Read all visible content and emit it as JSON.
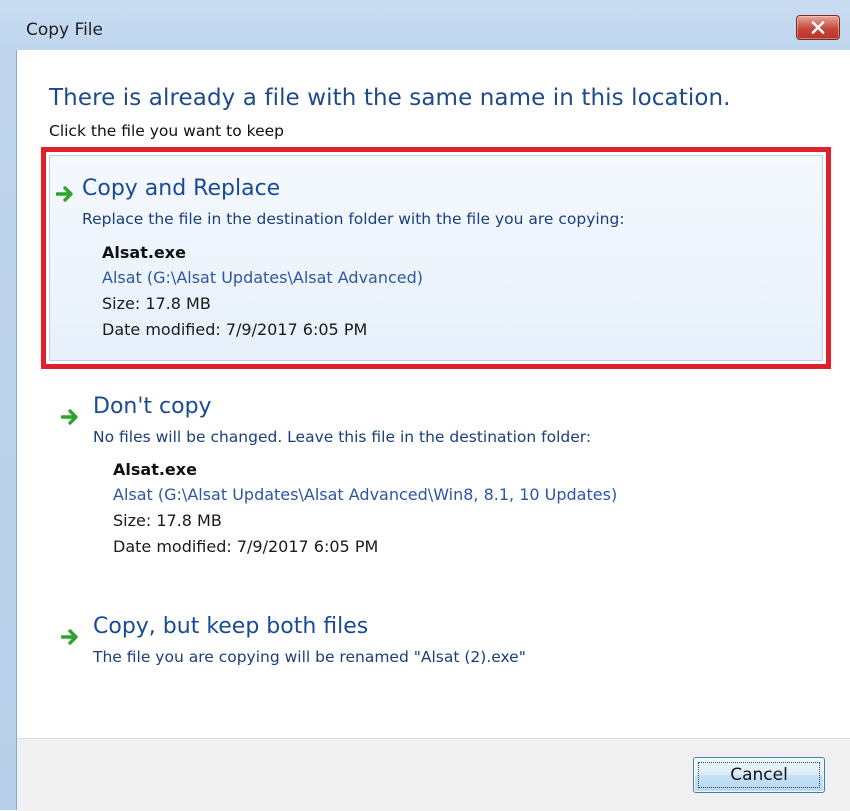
{
  "window": {
    "title": "Copy File",
    "close_icon": "close-icon"
  },
  "heading": "There is already a file with the same name in this location.",
  "subheading": "Click the file you want to keep",
  "options": [
    {
      "title": "Copy and Replace",
      "description": "Replace the file in the destination folder with the file you are copying:",
      "file_name": "Alsat.exe",
      "file_path": "Alsat (G:\\Alsat Updates\\Alsat Advanced)",
      "size": "Size: 17.8 MB",
      "date_modified": "Date modified: 7/9/2017 6:05 PM",
      "icon": "green-arrow-icon",
      "selected": true
    },
    {
      "title": "Don't copy",
      "description": "No files will be changed. Leave this file in the destination folder:",
      "file_name": "Alsat.exe",
      "file_path": "Alsat (G:\\Alsat Updates\\Alsat Advanced\\Win8, 8.1, 10 Updates)",
      "size": "Size: 17.8 MB",
      "date_modified": "Date modified: 7/9/2017 6:05 PM",
      "icon": "green-arrow-icon"
    },
    {
      "title": "Copy, but keep both files",
      "description": "The file you are copying will be renamed \"Alsat (2).exe\"",
      "icon": "green-arrow-icon"
    }
  ],
  "footer": {
    "cancel_label": "Cancel"
  },
  "colors": {
    "highlight_border": "#e0202a",
    "heading": "#1d4a8a",
    "arrow": "#2fa32f"
  }
}
